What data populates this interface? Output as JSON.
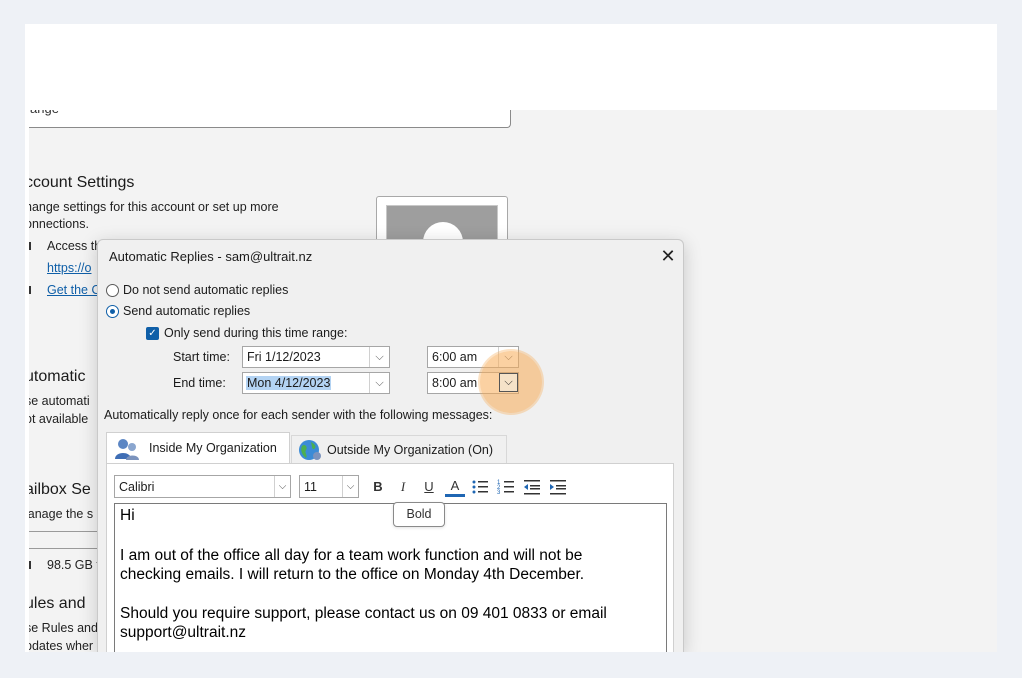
{
  "background": {
    "top_input_text": "ange",
    "account_settings": {
      "heading": "ccount Settings",
      "desc_line1": "hange settings for this account or set up more",
      "desc_line2": "onnections.",
      "item1": "Access th",
      "link1": "https://o",
      "link2": "Get the O"
    },
    "automatic": {
      "heading": "utomatic",
      "line1": "se automati",
      "line2": "ot available"
    },
    "mailbox": {
      "heading": "ailbox Se",
      "line1": "lanage the s",
      "size": "98.5 GB f"
    },
    "rules": {
      "heading": "ules and",
      "line1": "se Rules and",
      "line2": "pdates wher"
    }
  },
  "dialog": {
    "title": "Automatic Replies - sam@ultrait.nz",
    "close_glyph": "✕",
    "radio_off_label": "Do not send automatic replies",
    "radio_on_label": "Send automatic replies",
    "time_range_label": "Only send during this time range:",
    "start_label": "Start time:",
    "start_date": "Fri 1/12/2023",
    "start_time": "6:00 am",
    "end_label": "End time:",
    "end_date": "Mon 4/12/2023",
    "end_time": "8:00 am",
    "instruction": "Automatically reply once for each sender with the following messages:",
    "tabs": [
      {
        "label": "Inside My Organization"
      },
      {
        "label": "Outside My Organization (On)"
      }
    ],
    "toolbar": {
      "font": "Calibri",
      "size": "11",
      "bold": "B",
      "italic": "I",
      "underline": "U",
      "font_color": "A",
      "tooltip": "Bold"
    },
    "message": {
      "line1": "Hi",
      "line2": "I am out of the office all day for a team work function and will not be",
      "line3": "checking emails. I will return to the office on Monday 4th December.",
      "line4": "Should you require support, please contact us on 09 401 0833 or email",
      "line5": "support@ultrait.nz"
    }
  },
  "colors": {
    "accent": "#0f5fa8",
    "highlight": "#f7ab55",
    "selection": "#b3d3f3"
  }
}
